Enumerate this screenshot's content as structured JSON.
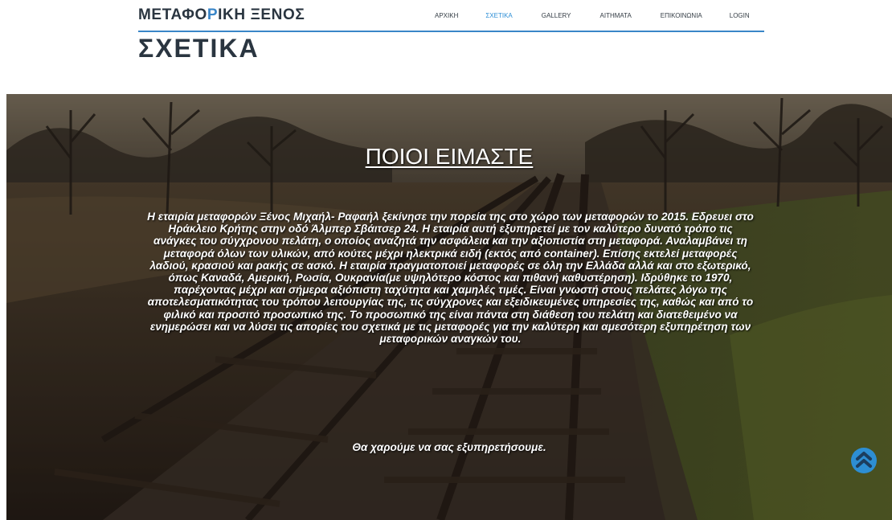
{
  "brand": {
    "logo_part1": "ΜΕΤΑΦΟ",
    "logo_accent": "Ρ",
    "logo_part2": "ΙΚΗ ΞΕΝΟΣ",
    "accent_color": "#3a86c8"
  },
  "nav": {
    "items": [
      {
        "label": "ΑΡΧΙΚΗ",
        "active": false
      },
      {
        "label": "ΣΧΕΤΙΚΑ",
        "active": true
      },
      {
        "label": "GALLERY",
        "active": false
      },
      {
        "label": "ΑΙΤΗΜΑΤΑ",
        "active": false
      },
      {
        "label": "ΕΠΙΚΟΙΝΩΝΙΑ",
        "active": false
      },
      {
        "label": "LOGIN",
        "active": false
      }
    ],
    "active_color": "#2f8fd6"
  },
  "page": {
    "title": "ΣΧΕΤΙΚΑ"
  },
  "hero": {
    "heading": "ΠΟΙΟΙ ΕΙΜΑΣΤΕ",
    "paragraph": "Η εταιρία μεταφορών Ξένος Μιχαήλ- Ραφαήλ ξεκίνησε την πορεία της στο χώρο των μεταφορών το 2015. Εδρευει στο Ηράκλειο Κρήτης στην οδό Άλμπερ Σβάιτσερ 24. Η εταιρία αυτή εξυπηρετεί με τον καλύτερο δυνατό τρόπο τις ανάγκες του σύγχρονου πελάτη, ο οποίος αναζητά την ασφάλεια και την αξιοπιστία στη μεταφορά. Αναλαμβάνει τη μεταφορά όλων των υλικών, από κούτες μέχρι ηλεκτρικά ειδή (εκτός από container). Επίσης εκτελεί μεταφορές λαδιού, κρασιού και ρακής σε ασκό. Η εταιρία πραγματοποιεί μεταφορές σε όλη την Ελλάδα αλλά και στο εξωτερικό, όπως Καναδά, Αμερική, Ρωσία, Ουκρανία(με υψηλότερο κόστος και πιθανή καθυστέρηση). Ιδρύθηκε το 1970, παρέχοντας μέχρι και σήμερα αξιόπιστη ταχύτητα και χαμηλές τιμές. Είναι γνωστή στους πελάτες λόγω της αποτελεσματικότητας του τρόπου λειτουργίας της, τις σύγχρονες και εξειδικευμένες υπηρεσίες της, καθώς και από το φιλικό και προσιτό προσωπικό της. Το προσωπικό της είναι πάντα στη διάθεση του πελάτη και διατεθειμένο να ενημερώσει και να λύσει τις απορίες του σχετικά με τις μεταφορές για την καλύτερη και αμεσότερη εξυπηρέτηση των μεταφορικών αναγκών του.",
    "closing": "Θα χαρούμε να σας εξυπηρετήσουμε."
  },
  "icons": {
    "scroll_top": "chevron-up-icon",
    "scroll_top_color": "#2d8ed3"
  }
}
